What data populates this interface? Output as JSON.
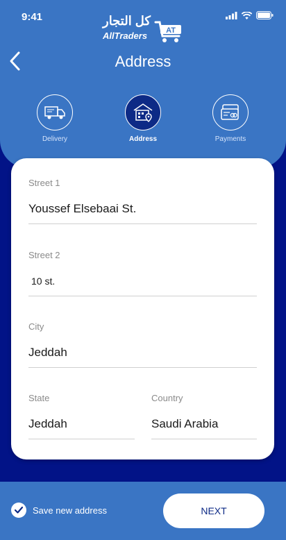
{
  "status_bar": {
    "time": "9:41"
  },
  "logo": {
    "arabic": "كل التجار",
    "english": "AllTraders",
    "badge": "AT"
  },
  "header": {
    "title": "Address"
  },
  "steps": [
    {
      "label": "Delivery",
      "icon": "delivery-truck-icon",
      "active": false
    },
    {
      "label": "Address",
      "icon": "address-building-icon",
      "active": true
    },
    {
      "label": "Payments",
      "icon": "payment-card-icon",
      "active": false
    }
  ],
  "form": {
    "street1": {
      "label": "Street 1",
      "value": "Youssef Elsebaai St."
    },
    "street2": {
      "label": "Street 2",
      "value": "10 st."
    },
    "city": {
      "label": "City",
      "value": "Jeddah"
    },
    "state": {
      "label": "State",
      "value": "Jeddah"
    },
    "country": {
      "label": "Country",
      "value": "Saudi Arabia"
    }
  },
  "footer": {
    "save_label": "Save new address",
    "save_checked": true,
    "next_label": "NEXT"
  },
  "colors": {
    "primary": "#3a75c4",
    "background": "#021387",
    "active_step": "#0d2a86"
  }
}
